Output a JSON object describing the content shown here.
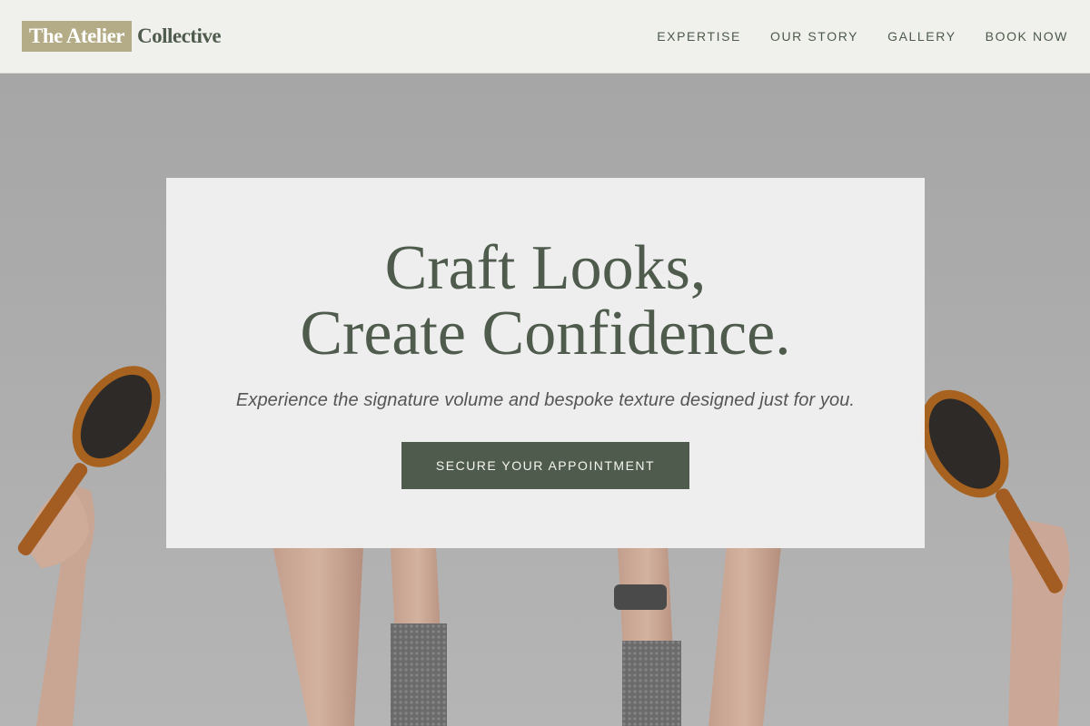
{
  "brand": {
    "mark": "The Atelier",
    "rest": "Collective"
  },
  "nav": {
    "items": [
      {
        "label": "EXPERTISE",
        "name": "nav-expertise"
      },
      {
        "label": "OUR STORY",
        "name": "nav-our-story"
      },
      {
        "label": "GALLERY",
        "name": "nav-gallery"
      },
      {
        "label": "BOOK NOW",
        "name": "nav-book-now"
      }
    ]
  },
  "hero": {
    "title_line1": "Craft Looks,",
    "title_line2": "Create Confidence.",
    "subtitle": "Experience the signature volume and bespoke texture designed just for you.",
    "cta_label": "SECURE YOUR APPOINTMENT",
    "image": "hands-holding-hair-brushes-photo"
  },
  "colors": {
    "accent_green": "#4f5c4d",
    "logo_tan": "#b3ac86",
    "header_bg": "#f0f1ed"
  }
}
